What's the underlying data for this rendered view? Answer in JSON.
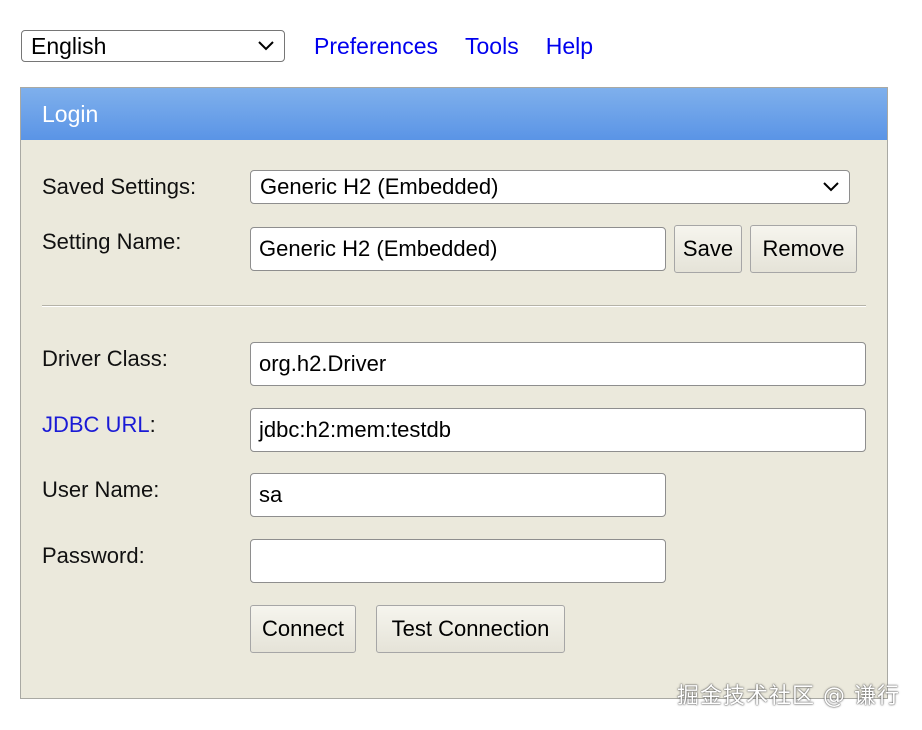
{
  "top_bar": {
    "language": "English",
    "links": [
      "Preferences",
      "Tools",
      "Help"
    ]
  },
  "login": {
    "title": "Login",
    "saved_settings_label": "Saved Settings:",
    "saved_settings_value": "Generic H2 (Embedded)",
    "setting_name_label": "Setting Name:",
    "setting_name_value": "Generic H2 (Embedded)",
    "save_label": "Save",
    "remove_label": "Remove",
    "driver_class_label": "Driver Class:",
    "driver_class_value": "org.h2.Driver",
    "jdbc_url_link": "JDBC URL",
    "jdbc_url_colon": ":",
    "jdbc_url_value": "jdbc:h2:mem:testdb",
    "user_name_label": "User Name:",
    "user_name_value": "sa",
    "password_label": "Password:",
    "password_value": "",
    "connect_label": "Connect",
    "test_connection_label": "Test Connection"
  },
  "watermark": "掘金技术社区 @ 谦行",
  "colors": {
    "header_blue": "#6ba1ea",
    "panel_bg": "#ebe9dc",
    "link_blue": "#0000ee"
  }
}
